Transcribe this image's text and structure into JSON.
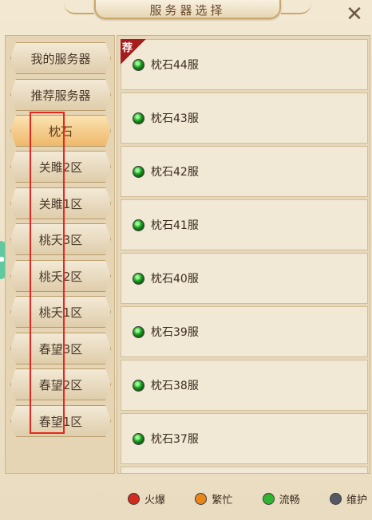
{
  "header": {
    "title": "服务器选择"
  },
  "categories": [
    {
      "label": "我的服务器"
    },
    {
      "label": "推荐服务器"
    },
    {
      "label": "枕石",
      "selected": true
    },
    {
      "label": "关雎2区"
    },
    {
      "label": "关雎1区"
    },
    {
      "label": "桃夭3区"
    },
    {
      "label": "桃夭2区"
    },
    {
      "label": "桃夭1区"
    },
    {
      "label": "春望3区"
    },
    {
      "label": "春望2区"
    },
    {
      "label": "春望1区"
    }
  ],
  "servers": [
    {
      "name": "枕石44服",
      "status": "流畅",
      "recommend": "荐"
    },
    {
      "name": "枕石43服",
      "status": "流畅"
    },
    {
      "name": "枕石42服",
      "status": "流畅"
    },
    {
      "name": "枕石41服",
      "status": "流畅"
    },
    {
      "name": "枕石40服",
      "status": "流畅"
    },
    {
      "name": "枕石39服",
      "status": "流畅"
    },
    {
      "name": "枕石38服",
      "status": "流畅"
    },
    {
      "name": "枕石37服",
      "status": "流畅"
    }
  ],
  "legend": [
    {
      "label": "火爆",
      "color": "#d42a1f"
    },
    {
      "label": "繁忙",
      "color": "#e8861a"
    },
    {
      "label": "流畅",
      "color": "#2fb52f"
    },
    {
      "label": "维护",
      "color": "#555a62"
    }
  ]
}
